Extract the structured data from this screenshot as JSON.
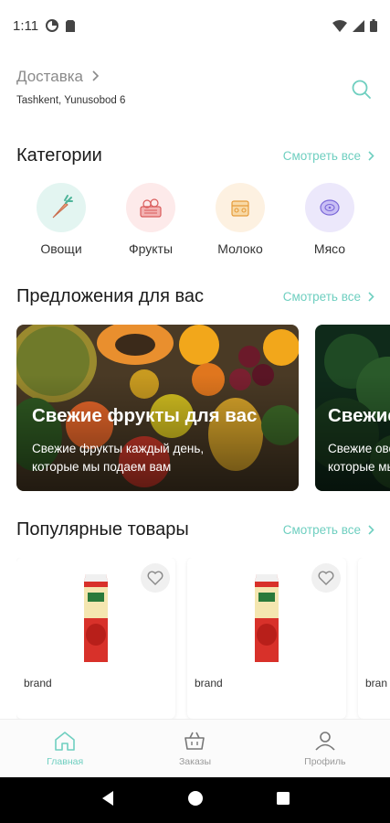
{
  "status_bar": {
    "time": "1:11"
  },
  "delivery": {
    "title": "Доставка",
    "address": "Tashkent, Yunusobod 6"
  },
  "categories_section": {
    "title": "Категории",
    "see_all": "Смотреть все",
    "items": [
      {
        "label": "Овощи",
        "icon": "carrot-icon",
        "color": "#e3f5f1"
      },
      {
        "label": "Фрукты",
        "icon": "fruit-basket-icon",
        "color": "#fdeaea"
      },
      {
        "label": "Молоко",
        "icon": "milk-icon",
        "color": "#fdf1e1"
      },
      {
        "label": "Мясо",
        "icon": "meat-icon",
        "color": "#ece8fb"
      }
    ]
  },
  "offers_section": {
    "title": "Предложения для вас",
    "see_all": "Смотреть все",
    "cards": [
      {
        "title": "Свежие фрукты для вас",
        "subtitle": "Свежие фрукты каждый день, которые мы подаем вам"
      },
      {
        "title": "Свежие",
        "subtitle": "Свежие ово которые мы"
      }
    ]
  },
  "popular_section": {
    "title": "Популярные товары",
    "see_all": "Смотреть все",
    "products": [
      {
        "brand": "brand"
      },
      {
        "brand": "brand"
      },
      {
        "brand": "bran"
      }
    ]
  },
  "bottom_nav": {
    "items": [
      {
        "label": "Главная",
        "icon": "home-icon",
        "active": true
      },
      {
        "label": "Заказы",
        "icon": "basket-icon",
        "active": false
      },
      {
        "label": "Профиль",
        "icon": "user-icon",
        "active": false
      }
    ]
  },
  "colors": {
    "accent": "#6fcfc0",
    "text": "#1a1a1a",
    "muted": "#8a8a8a"
  }
}
